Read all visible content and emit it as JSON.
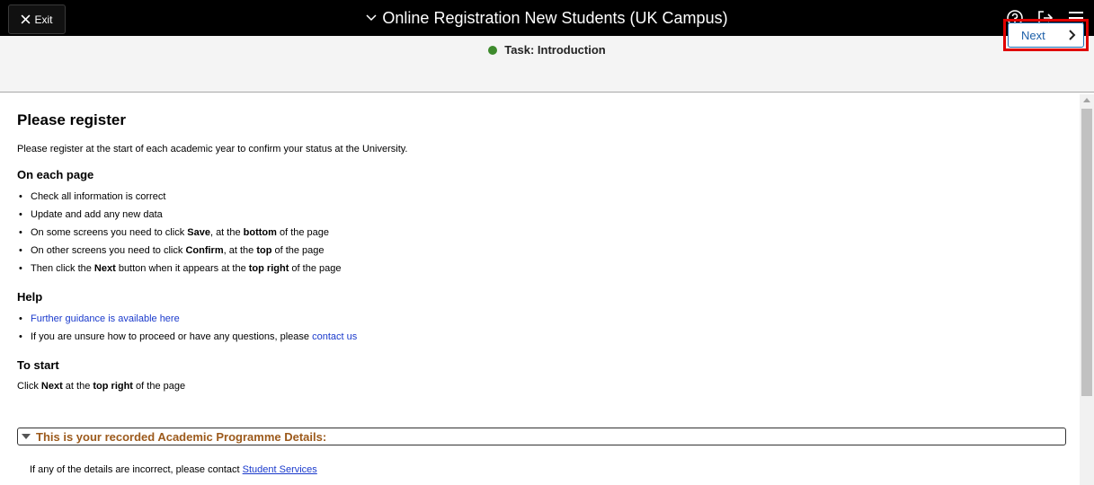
{
  "header": {
    "exit_label": "Exit",
    "title": "Online Registration New Students (UK Campus)",
    "icons": [
      "help-icon",
      "signout-icon",
      "menu-icon"
    ]
  },
  "task": {
    "label": "Task: Introduction",
    "status_color": "#3d8a2c",
    "next_label": "Next"
  },
  "main": {
    "heading": "Please register",
    "intro": "Please register at the start of each academic year to confirm your status at the University.",
    "on_each_page": {
      "heading": "On each page",
      "item1": "Check all information is correct",
      "item2": "Update and add any new data",
      "item3": {
        "a": "On some screens you need to click ",
        "b": "Save",
        "c": ", at the ",
        "d": "bottom",
        "e": " of the page"
      },
      "item4": {
        "a": "On other screens you need to click ",
        "b": "Confirm",
        "c": ", at the ",
        "d": "top",
        "e": " of the page"
      },
      "item5": {
        "a": "Then click the ",
        "b": "Next",
        "c": " button when it appears at the ",
        "d": "top right",
        "e": " of the page"
      }
    },
    "help": {
      "heading": "Help",
      "guidance_link": "Further guidance is available here",
      "contact_text": "If you are unsure how to proceed or have any questions, please ",
      "contact_link": "contact us"
    },
    "to_start": {
      "heading": "To start",
      "a": "Click ",
      "b": "Next",
      "c": " at the ",
      "d": "top right",
      "e": " of the page"
    },
    "section": {
      "title": "This is your recorded Academic Programme Details:",
      "color": "#9c5a1c",
      "note": "If any of the details are incorrect, please contact ",
      "note_link": "Student Services"
    }
  },
  "colors": {
    "topbar": "#000000",
    "taskbar": "#f4f4f4",
    "link": "#1a3acc",
    "highlight": "#e00000"
  }
}
